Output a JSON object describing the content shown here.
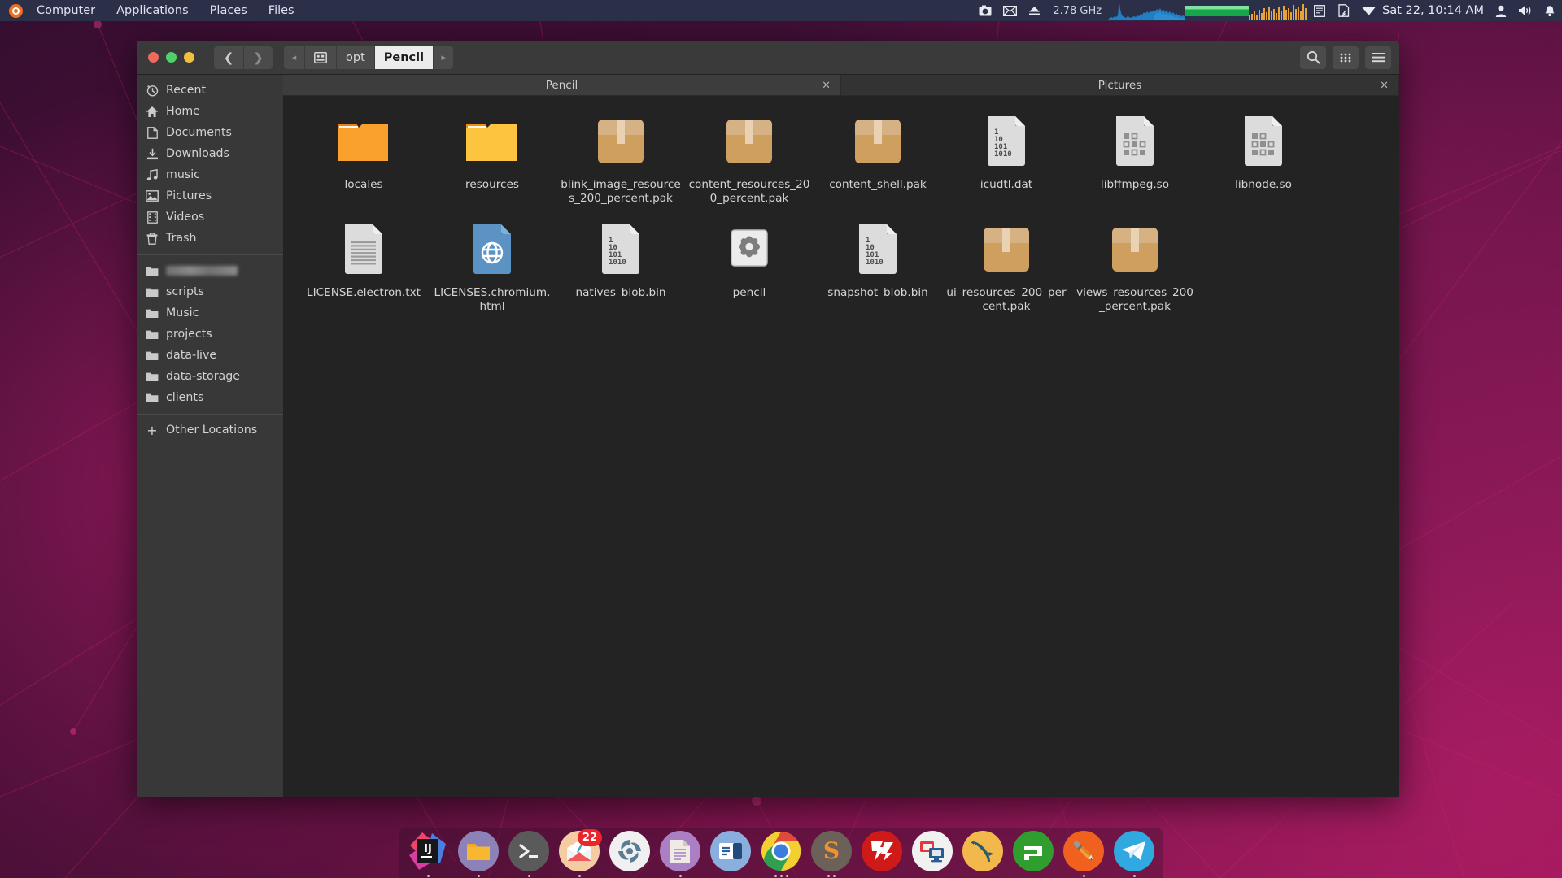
{
  "top_panel": {
    "logo": "ubuntu-logo-icon",
    "menus": [
      "Computer",
      "Applications",
      "Places",
      "Files"
    ],
    "tray": {
      "screenshot_icon": "camera-icon",
      "mail_icon": "envelope-icon",
      "eject_icon": "eject-icon",
      "cpu_freq": "2.78 GHz",
      "network_graph": "network-graph-icon",
      "memory_bar": "memory-usage-icon",
      "cpu_graph": "cpu-graph-icon",
      "list_icon": "notes-icon",
      "update_icon": "software-update-icon",
      "network_icon": "wifi-icon",
      "clock": "Sat 22, 10:14 AM",
      "user_icon": "user-icon",
      "volume_icon": "volume-icon",
      "bell_icon": "bell-icon"
    }
  },
  "file_manager": {
    "window_buttons": {
      "close": "close-window",
      "minimize": "minimize-window",
      "maximize": "maximize-window"
    },
    "nav": {
      "back": "❮",
      "forward": "❯"
    },
    "breadcrumb": {
      "scroll_left": "◂",
      "root_icon": "computer-icon",
      "items": [
        "opt",
        "Pencil"
      ],
      "current_index": 1,
      "scroll_right": "▸"
    },
    "header_buttons": {
      "search": "search-icon",
      "view_grid": "view-grid-icon",
      "menu": "hamburger-menu-icon"
    },
    "sidebar": {
      "items": [
        {
          "label": "Recent",
          "icon": "clock-icon",
          "redacted": false
        },
        {
          "label": "Home",
          "icon": "home-icon",
          "redacted": false
        },
        {
          "label": "Documents",
          "icon": "document-icon",
          "redacted": false
        },
        {
          "label": "Downloads",
          "icon": "download-icon",
          "redacted": false
        },
        {
          "label": "music",
          "icon": "music-note-icon",
          "redacted": false
        },
        {
          "label": "Pictures",
          "icon": "image-icon",
          "redacted": false
        },
        {
          "label": "Videos",
          "icon": "film-icon",
          "redacted": false
        },
        {
          "label": "Trash",
          "icon": "trash-icon",
          "redacted": false
        }
      ],
      "bookmarks": [
        {
          "label": "",
          "icon": "folder-icon",
          "redacted": true
        },
        {
          "label": "scripts",
          "icon": "folder-icon",
          "redacted": false
        },
        {
          "label": "Music",
          "icon": "folder-icon",
          "redacted": false
        },
        {
          "label": "projects",
          "icon": "folder-icon",
          "redacted": false
        },
        {
          "label": "data-live",
          "icon": "folder-icon",
          "redacted": false
        },
        {
          "label": "data-storage",
          "icon": "folder-icon",
          "redacted": false
        },
        {
          "label": "clients",
          "icon": "folder-icon",
          "redacted": false
        }
      ],
      "other_locations": {
        "label": "Other Locations",
        "icon": "plus-icon"
      }
    },
    "tabs": [
      {
        "label": "Pencil",
        "close": "×",
        "active": true
      },
      {
        "label": "Pictures",
        "close": "×",
        "active": false
      }
    ],
    "files": [
      {
        "name": "locales",
        "type": "folder-open-dark"
      },
      {
        "name": "resources",
        "type": "folder-open"
      },
      {
        "name": "blink_image_resources_200_percent.pak",
        "type": "package"
      },
      {
        "name": "content_resources_200_percent.pak",
        "type": "package"
      },
      {
        "name": "content_shell.pak",
        "type": "package"
      },
      {
        "name": "icudtl.dat",
        "type": "binary"
      },
      {
        "name": "libffmpeg.so",
        "type": "library"
      },
      {
        "name": "libnode.so",
        "type": "library"
      },
      {
        "name": "LICENSE.electron.txt",
        "type": "text"
      },
      {
        "name": "LICENSES.chromium.html",
        "type": "html"
      },
      {
        "name": "natives_blob.bin",
        "type": "binary"
      },
      {
        "name": "pencil",
        "type": "executable"
      },
      {
        "name": "snapshot_blob.bin",
        "type": "binary"
      },
      {
        "name": "ui_resources_200_percent.pak",
        "type": "package"
      },
      {
        "name": "views_resources_200_percent.pak",
        "type": "package"
      }
    ]
  },
  "dock": {
    "items": [
      {
        "name": "IntelliJ IDEA",
        "icon": "intellij-idea-icon",
        "badge": null,
        "running_dots": 1
      },
      {
        "name": "Files",
        "icon": "files-folder-icon",
        "badge": null,
        "running_dots": 1
      },
      {
        "name": "Terminal",
        "icon": "terminal-icon",
        "badge": null,
        "running_dots": 1
      },
      {
        "name": "Mail",
        "icon": "mail-client-icon",
        "badge": "22",
        "running_dots": 1
      },
      {
        "name": "Photos",
        "icon": "shotwell-icon",
        "badge": null,
        "running_dots": 0
      },
      {
        "name": "Text Editor",
        "icon": "text-editor-icon",
        "badge": null,
        "running_dots": 1
      },
      {
        "name": "Calendar",
        "icon": "calendar-icon",
        "badge": null,
        "running_dots": 0
      },
      {
        "name": "Google Chrome",
        "icon": "chrome-icon",
        "badge": null,
        "running_dots": 3
      },
      {
        "name": "Sublime Text",
        "icon": "sublime-text-icon",
        "badge": null,
        "running_dots": 2
      },
      {
        "name": "FileZilla",
        "icon": "filezilla-icon",
        "badge": null,
        "running_dots": 0
      },
      {
        "name": "Remmina",
        "icon": "remmina-icon",
        "badge": null,
        "running_dots": 0
      },
      {
        "name": "MySQL Workbench",
        "icon": "mysql-workbench-icon",
        "badge": null,
        "running_dots": 0
      },
      {
        "name": "Sublime Merge",
        "icon": "sublime-merge-icon",
        "badge": null,
        "running_dots": 0
      },
      {
        "name": "Pencil",
        "icon": "pencil-app-icon",
        "badge": null,
        "running_dots": 1
      },
      {
        "name": "Telegram",
        "icon": "telegram-icon",
        "badge": null,
        "running_dots": 1
      }
    ]
  },
  "colors": {
    "panel_bg": "#2c2f48",
    "window_bg": "#2b2b2b",
    "sidebar_bg": "#383838",
    "content_bg": "#232323",
    "accent_orange": "#f07020",
    "folder_yellow": "#fdc53f",
    "folder_dark": "#f8a833",
    "package_tan": "#cf9f5f",
    "badge_red": "#e8262b"
  }
}
